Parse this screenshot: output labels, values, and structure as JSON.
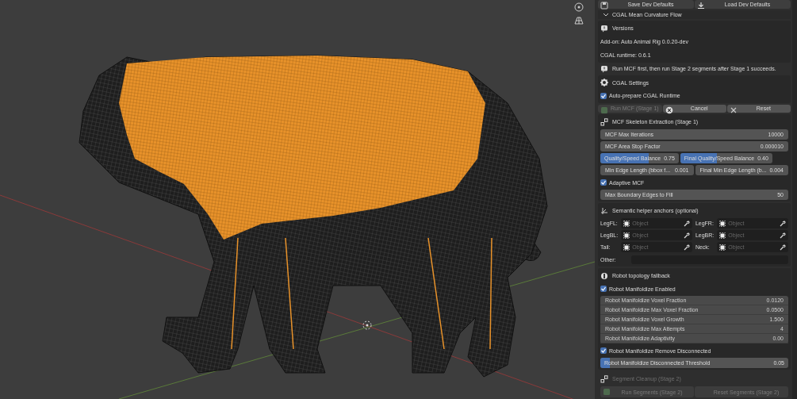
{
  "top_buttons": [
    {
      "label": "Save Dev Defaults"
    },
    {
      "label": "Load Dev Defaults"
    }
  ],
  "section": {
    "title": "CGAL Mean Curvature Flow",
    "expanded": true
  },
  "versions": {
    "title": "Versions",
    "lines": [
      "Add-on: Auto Animal Rig 0.0.20-dev",
      "CGAL runtime: 0.6.1"
    ]
  },
  "info": "Run MCF first, then run Stage 2 segments after Stage 1 succeeds.",
  "cgal_settings": {
    "title": "CGAL Settings",
    "rows": [
      {
        "kind": "checkbox",
        "label": "Auto-prepare CGAL Runtime",
        "checked": true
      }
    ]
  },
  "stage1_buttons": [
    {
      "label": "Run MCF (Stage 1)",
      "disabled": true
    },
    {
      "label": "Cancel",
      "disabled": false
    },
    {
      "label": "Reset",
      "disabled": false
    }
  ],
  "skeleton": {
    "title": "MCF Skeleton Extraction (Stage 1)",
    "rows": [
      {
        "kind": "field",
        "label": "MCF Max Iterations",
        "value": "10000"
      },
      {
        "kind": "field",
        "label": "MCF Area Stop Factor",
        "value": "0.000010"
      },
      {
        "kind": "pair",
        "items": [
          {
            "kind": "slider",
            "label": "Quality/Speed Balance",
            "value": "0.75",
            "level": 0.62
          },
          {
            "kind": "slider",
            "label": "Final Quality/Speed Balance",
            "value": "0.40",
            "level": 0.4
          }
        ]
      },
      {
        "kind": "pair",
        "items": [
          {
            "kind": "field",
            "label": "Min Edge Length (bbox f...",
            "value": "0.001"
          },
          {
            "kind": "field",
            "label": "Final Min Edge Length (b...",
            "value": "0.004"
          }
        ]
      },
      {
        "kind": "checkbox",
        "label": "Adaptive MCF",
        "checked": true
      },
      {
        "kind": "field",
        "label": "Max Boundary Edges to Fill",
        "value": "50"
      }
    ]
  },
  "anchors": {
    "title": "Semantic helper anchors (optional)",
    "pickers": [
      {
        "label": "LegFL:",
        "placeholder": "Object"
      },
      {
        "label": "LegFR:",
        "placeholder": "Object"
      },
      {
        "label": "LegBL:",
        "placeholder": "Object"
      },
      {
        "label": "LegBR:",
        "placeholder": "Object"
      },
      {
        "label": "Tail:",
        "placeholder": "Object"
      },
      {
        "label": "Neck:",
        "placeholder": "Object"
      }
    ],
    "other": {
      "label": "Other:"
    }
  },
  "robot": {
    "title": "Robot topology fallback",
    "rows": [
      {
        "kind": "checkbox",
        "label": "Robot Manifoldize Enabled",
        "checked": true
      },
      {
        "kind": "group",
        "items": [
          {
            "kind": "field",
            "label": "Robot Manifoldize Voxel Fraction",
            "value": "0.0120"
          },
          {
            "kind": "field",
            "label": "Robot Manifoldize Max Voxel Fraction",
            "value": "0.0500"
          },
          {
            "kind": "field",
            "label": "Robot Manifoldize Voxel Growth",
            "value": "1.500"
          },
          {
            "kind": "field",
            "label": "Robot Manifoldize Max Attempts",
            "value": "4"
          },
          {
            "kind": "field",
            "label": "Robot Manifoldize Adaptivity",
            "value": "0.00"
          }
        ]
      },
      {
        "kind": "checkbox",
        "label": "Robot Manifoldize Remove Disconnected",
        "checked": true
      },
      {
        "kind": "slider",
        "label": "Robot Manifoldize Disconnected Threshold",
        "value": "0.05",
        "level": 0.05
      }
    ]
  },
  "segment": {
    "title": "Segment Cleanup (Stage 2)",
    "disabled": true,
    "buttons": [
      {
        "label": "Run Segments (Stage 2)",
        "disabled": true
      },
      {
        "label": "Reset Segments (Stage 2)",
        "disabled": true
      }
    ]
  }
}
